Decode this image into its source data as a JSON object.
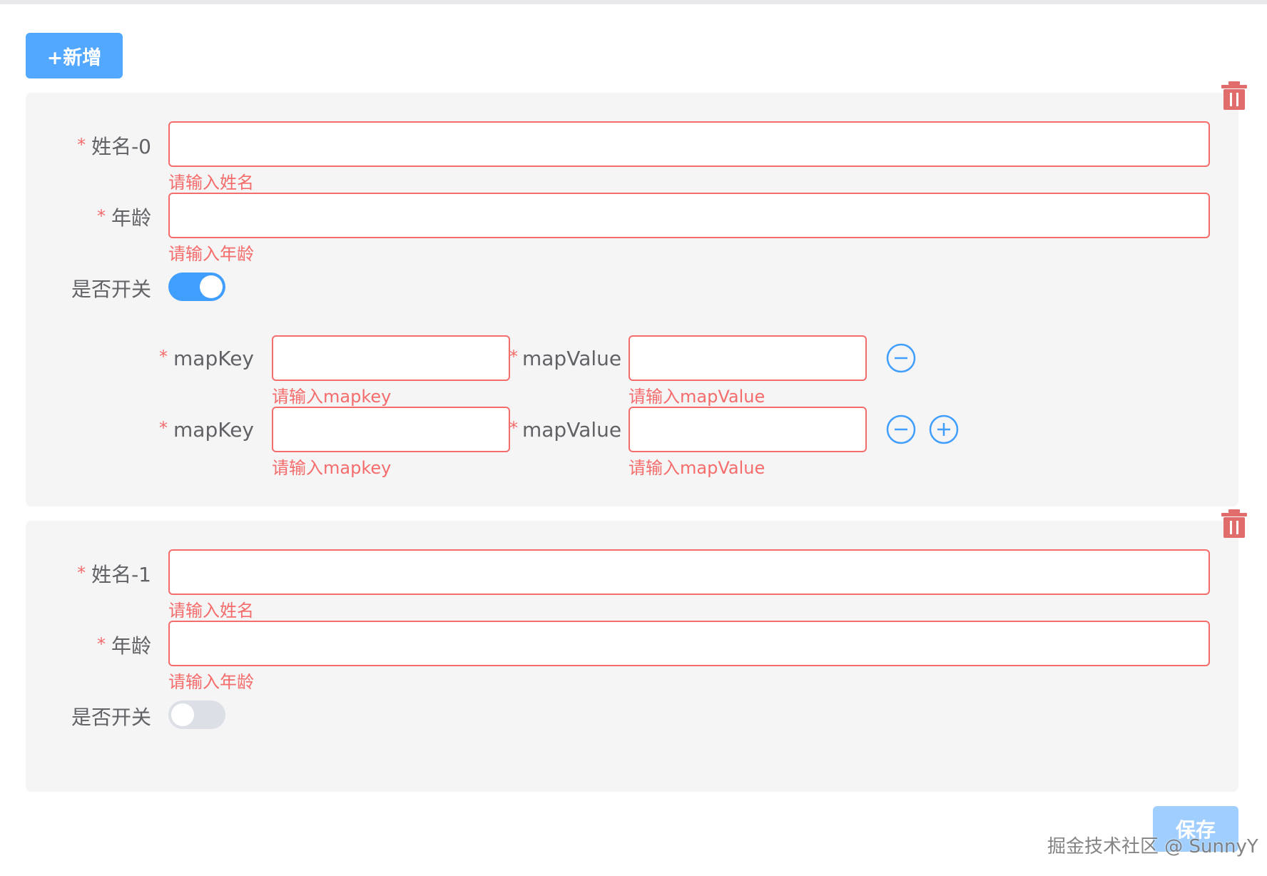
{
  "toolbar": {
    "add_label": "+新增"
  },
  "groups": [
    {
      "name_label": "姓名-0",
      "name_value": "",
      "name_error": "请输入姓名",
      "age_label": "年龄",
      "age_value": "",
      "age_error": "请输入年龄",
      "switch_label": "是否开关",
      "switch_on": true,
      "map_rows": [
        {
          "key_label": "mapKey",
          "key_value": "",
          "key_error": "请输入mapkey",
          "value_label": "mapValue",
          "value_value": "",
          "value_error": "请输入mapValue"
        },
        {
          "key_label": "mapKey",
          "key_value": "",
          "key_error": "请输入mapkey",
          "value_label": "mapValue",
          "value_value": "",
          "value_error": "请输入mapValue"
        }
      ]
    },
    {
      "name_label": "姓名-1",
      "name_value": "",
      "name_error": "请输入姓名",
      "age_label": "年龄",
      "age_value": "",
      "age_error": "请输入年龄",
      "switch_label": "是否开关",
      "switch_on": false,
      "map_rows": []
    }
  ],
  "footer": {
    "save_label": "保存"
  },
  "watermark": "掘金技术社区 @ SunnyY",
  "colors": {
    "primary": "#409eff",
    "error": "#f56c6c",
    "card_bg": "#f5f5f5",
    "save_disabled": "#a0cfff"
  },
  "icons": {
    "delete": "trash-icon",
    "remove_row": "minus-circle-icon",
    "add_row": "plus-circle-icon"
  }
}
